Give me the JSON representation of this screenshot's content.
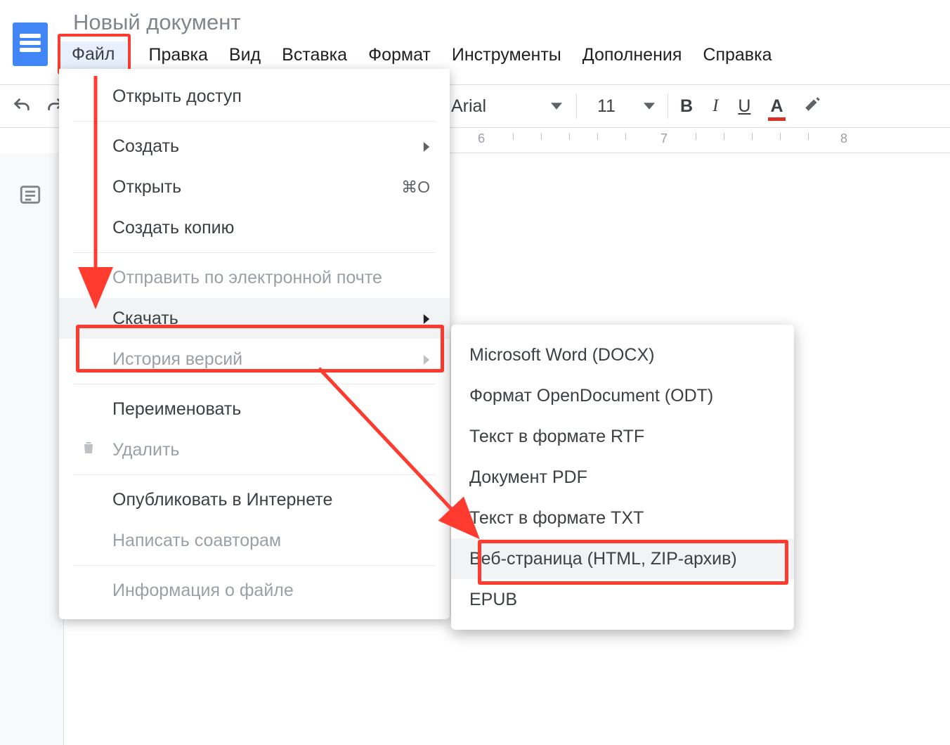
{
  "doc": {
    "title": "Новый документ"
  },
  "menubar": {
    "file": "Файл",
    "edit": "Правка",
    "view": "Вид",
    "insert": "Вставка",
    "format": "Формат",
    "tools": "Инструменты",
    "addons": "Дополнения",
    "help": "Справка"
  },
  "toolbar": {
    "font": "Arial",
    "size": "11",
    "bold": "B",
    "italic": "I",
    "underline": "U",
    "textcolor_letter": "A"
  },
  "ruler": {
    "n6": "6",
    "n7": "7",
    "n8": "8"
  },
  "filemenu": {
    "share": "Открыть доступ",
    "new": "Создать",
    "open": "Открыть",
    "open_sc": "⌘O",
    "makecopy": "Создать копию",
    "email": "Отправить по электронной почте",
    "download": "Скачать",
    "history": "История версий",
    "rename": "Переименовать",
    "delete": "Удалить",
    "publish": "Опубликовать в Интернете",
    "emailcollab": "Написать соавторам",
    "details": "Информация о файле"
  },
  "download_submenu": {
    "docx": "Microsoft Word (DOCX)",
    "odt": "Формат OpenDocument (ODT)",
    "rtf": "Текст в формате RTF",
    "pdf": "Документ PDF",
    "txt": "Текст в формате TXT",
    "html": "Веб-страница (HTML, ZIP-архив)",
    "epub": "EPUB"
  },
  "colors": {
    "highlight": "#ff3b30"
  }
}
